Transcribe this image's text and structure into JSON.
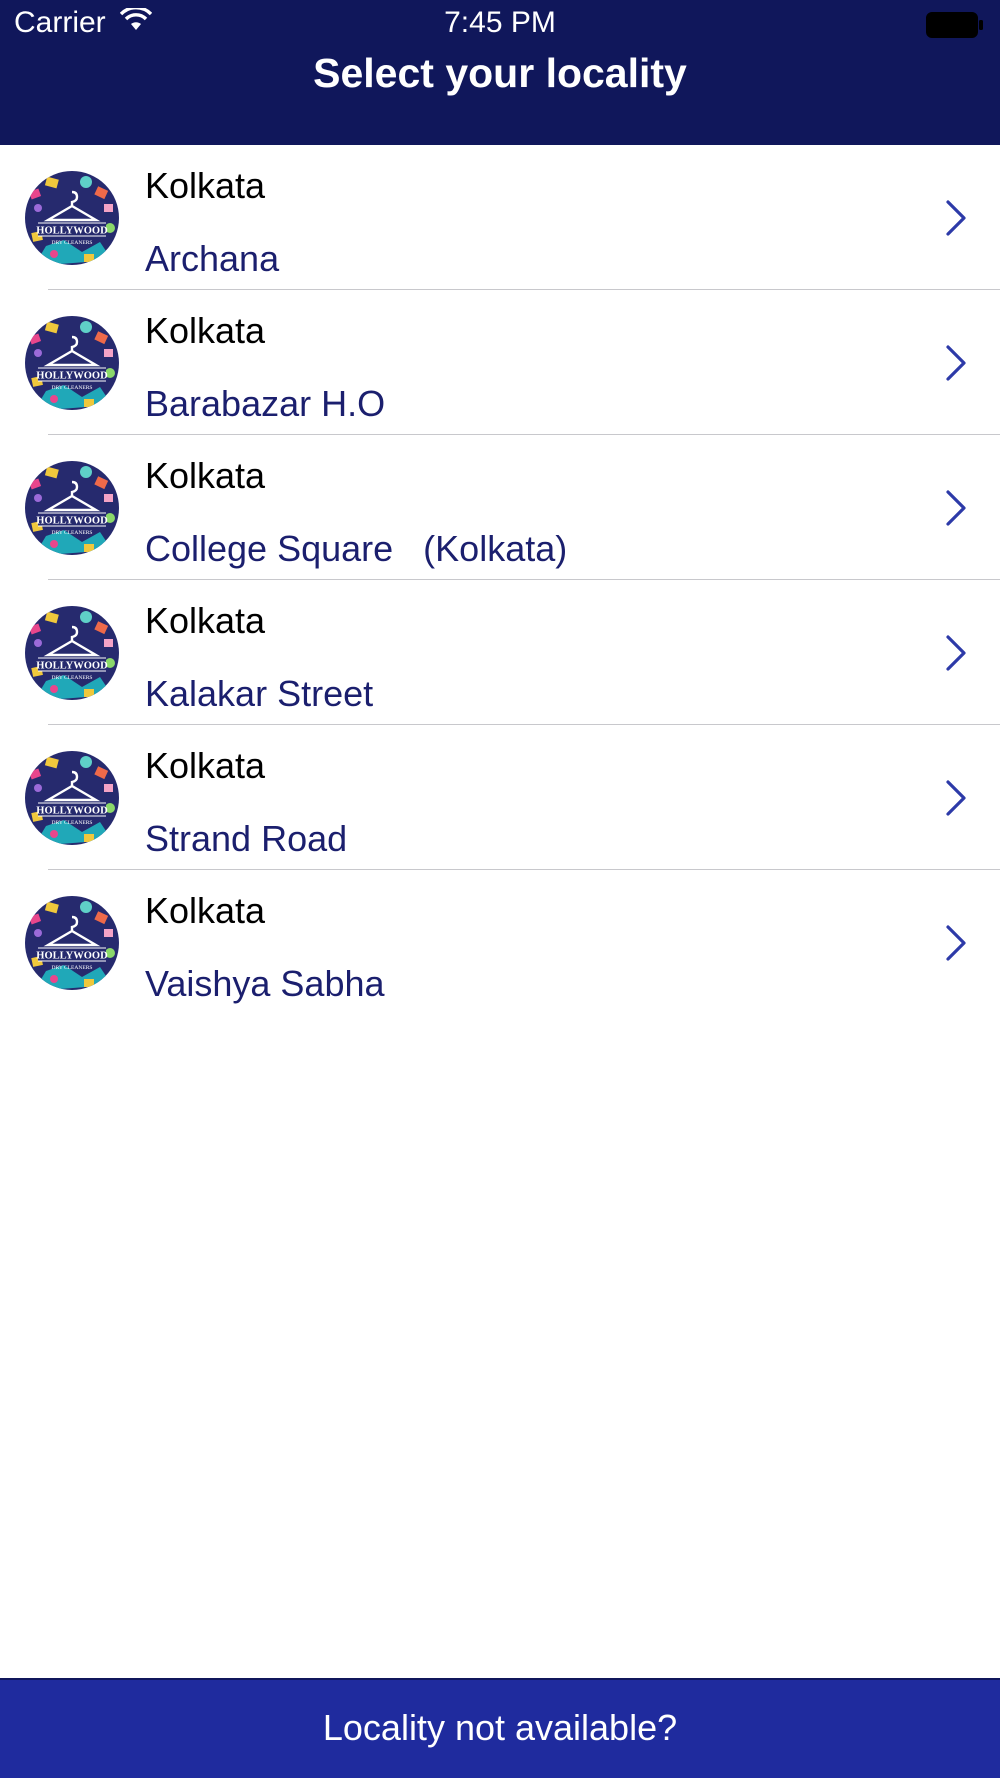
{
  "status_bar": {
    "carrier": "Carrier",
    "time": "7:45 PM"
  },
  "header": {
    "title": "Select your locality"
  },
  "colors": {
    "header_bg": "#10175b",
    "footer_bg": "#1f2b9e",
    "locality_text": "#1b1f6e",
    "chevron": "#2d3aa8"
  },
  "localities": [
    {
      "city": "Kolkata",
      "name": "Archana"
    },
    {
      "city": "Kolkata",
      "name": "Barabazar H.O"
    },
    {
      "city": "Kolkata",
      "name": "College Square   (Kolkata)"
    },
    {
      "city": "Kolkata",
      "name": "Kalakar Street"
    },
    {
      "city": "Kolkata",
      "name": "Strand Road"
    },
    {
      "city": "Kolkata",
      "name": "Vaishya Sabha"
    }
  ],
  "logo": {
    "text_main": "HOLLYWOOD",
    "text_sub": "DRY CLEANERS"
  },
  "footer": {
    "label": "Locality not available?"
  }
}
